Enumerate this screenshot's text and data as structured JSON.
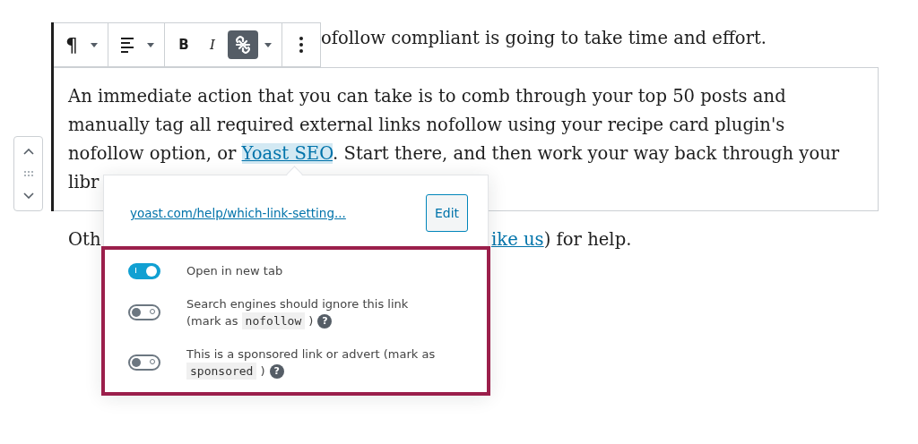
{
  "toolbar": {
    "groups": [
      {
        "buttons": [
          {
            "kind": "glyph",
            "text": "¶"
          },
          {
            "kind": "caret"
          }
        ]
      },
      {
        "buttons": [
          {
            "kind": "align"
          },
          {
            "kind": "caret"
          }
        ]
      },
      {
        "buttons": [
          {
            "kind": "bold",
            "text": "B",
            "pressed": false
          },
          {
            "kind": "italic",
            "text": "I",
            "pressed": false
          },
          {
            "kind": "link",
            "pressed": true
          },
          {
            "kind": "caret"
          }
        ]
      },
      {
        "buttons": [
          {
            "kind": "more"
          }
        ]
      }
    ]
  },
  "intro_line": "ofollow compliant is going to take time and effort.",
  "block": {
    "before": "An immediate action that you can take is to comb through your top 50 posts and manually tag all required external links nofollow using your recipe card plugin's nofollow option, or ",
    "link": {
      "text": "Yoast SEO",
      "selected": true
    },
    "after": ". Start there, and then work your way back through your libr"
  },
  "next_paragraph": {
    "before": "Oth",
    "link": "ike us",
    "after": ") for help."
  },
  "popover": {
    "url": "yoast.com/help/which-link-setting...",
    "edit": "Edit",
    "help_glyph": "?",
    "options": [
      {
        "before": "Open in new tab",
        "on": true,
        "help": false
      },
      {
        "before": "Search engines should ignore this link (mark as ",
        "code": "nofollow",
        "after": " )",
        "on": false,
        "help": true
      },
      {
        "before": "This is a sponsored link or advert (mark as ",
        "code": "sponsored",
        "after": " )",
        "on": false,
        "help": true
      }
    ]
  }
}
